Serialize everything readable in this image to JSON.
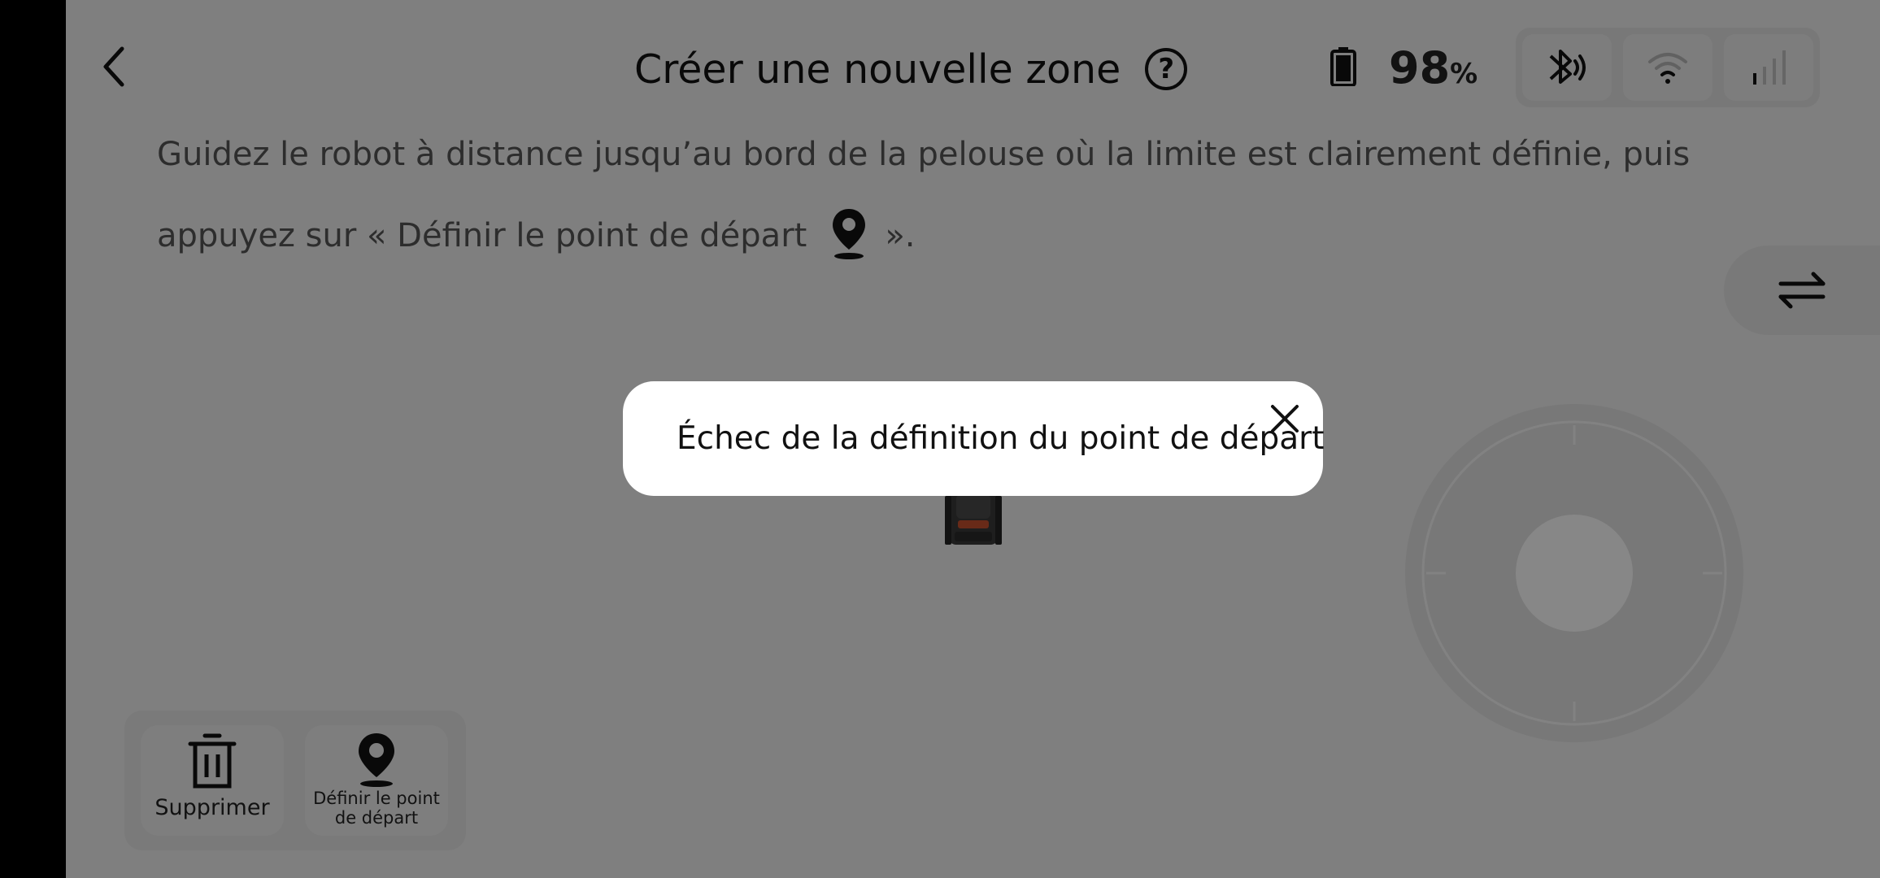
{
  "header": {
    "title": "Créer une nouvelle zone",
    "help_icon": "question-circle-icon",
    "help_glyph": "?",
    "battery_value": "98",
    "battery_unit": "%"
  },
  "connectivity": {
    "bluetooth_icon": "bluetooth-signal-icon",
    "wifi_icon": "wifi-icon",
    "cellular_icon": "cellular-signal-icon"
  },
  "instructions": {
    "line_part1": "Guidez le robot à distance jusqu’au bord de la pelouse où la limite est clairement définie, puis appuyez sur « Définir le point de départ",
    "line_part2": "»."
  },
  "toolbar": {
    "delete_label": "Supprimer",
    "set_start_label": "Définir le point de départ"
  },
  "toast": {
    "message": "Échec de la définition du point de départ"
  },
  "colors": {
    "overlay": "#00000078",
    "toast_bg": "#ffffff",
    "robot_accent": "#c4502e"
  }
}
